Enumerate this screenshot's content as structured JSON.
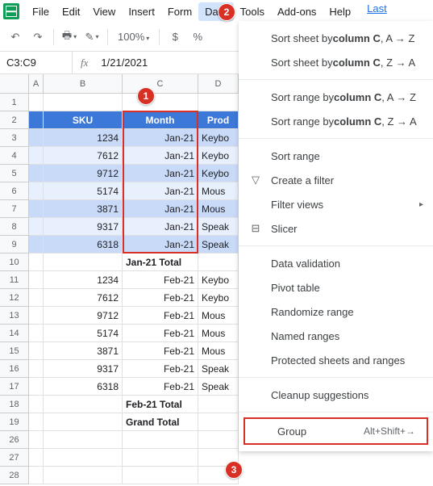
{
  "menu": {
    "items": [
      "File",
      "Edit",
      "View",
      "Insert",
      "Form",
      "Data",
      "Tools",
      "Add-ons",
      "Help"
    ],
    "last": "Last"
  },
  "toolbar": {
    "zoom": "100%",
    "currency": "$",
    "percent": "%"
  },
  "namebox": "C3:C9",
  "formula": "1/21/2021",
  "cols": [
    "A",
    "B",
    "C",
    "D"
  ],
  "headers": {
    "sku": "SKU",
    "month": "Month",
    "product": "Prod"
  },
  "rows": [
    {
      "n": "1",
      "B": "",
      "C": "",
      "D": ""
    },
    {
      "n": "2",
      "B": "SKU",
      "C": "Month",
      "D": "Prod",
      "hdr": true
    },
    {
      "n": "3",
      "B": "1234",
      "C": "Jan-21",
      "D": "Keybo",
      "band": "d"
    },
    {
      "n": "4",
      "B": "7612",
      "C": "Jan-21",
      "D": "Keybo",
      "band": "l"
    },
    {
      "n": "5",
      "B": "9712",
      "C": "Jan-21",
      "D": "Keybo",
      "band": "d"
    },
    {
      "n": "6",
      "B": "5174",
      "C": "Jan-21",
      "D": "Mous",
      "band": "l"
    },
    {
      "n": "7",
      "B": "3871",
      "C": "Jan-21",
      "D": "Mous",
      "band": "d"
    },
    {
      "n": "8",
      "B": "9317",
      "C": "Jan-21",
      "D": "Speak",
      "band": "l"
    },
    {
      "n": "9",
      "B": "6318",
      "C": "Jan-21",
      "D": "Speak",
      "band": "d"
    },
    {
      "n": "10",
      "B": "",
      "C": "Jan-21 Total",
      "D": "",
      "bold": true,
      "cL": true
    },
    {
      "n": "11",
      "B": "1234",
      "C": "Feb-21",
      "D": "Keybo"
    },
    {
      "n": "12",
      "B": "7612",
      "C": "Feb-21",
      "D": "Keybo"
    },
    {
      "n": "13",
      "B": "9712",
      "C": "Feb-21",
      "D": "Mous"
    },
    {
      "n": "14",
      "B": "5174",
      "C": "Feb-21",
      "D": "Mous"
    },
    {
      "n": "15",
      "B": "3871",
      "C": "Feb-21",
      "D": "Mous"
    },
    {
      "n": "16",
      "B": "9317",
      "C": "Feb-21",
      "D": "Speak"
    },
    {
      "n": "17",
      "B": "6318",
      "C": "Feb-21",
      "D": "Speak"
    },
    {
      "n": "18",
      "B": "",
      "C": "Feb-21 Total",
      "D": "",
      "bold": true,
      "cL": true
    },
    {
      "n": "19",
      "B": "",
      "C": "Grand Total",
      "D": "",
      "bold": true,
      "cL": true
    },
    {
      "n": "26",
      "B": "",
      "C": "",
      "D": ""
    },
    {
      "n": "27",
      "B": "",
      "C": "",
      "D": ""
    },
    {
      "n": "28",
      "B": "",
      "C": "",
      "D": ""
    }
  ],
  "dropdown": [
    {
      "t": "rich",
      "pre": "Sort sheet by ",
      "b": "column C",
      "post": ", A → Z"
    },
    {
      "t": "rich",
      "pre": "Sort sheet by ",
      "b": "column C",
      "post": ", Z → A"
    },
    {
      "t": "sep"
    },
    {
      "t": "rich",
      "pre": "Sort range by ",
      "b": "column C",
      "post": ", A → Z"
    },
    {
      "t": "rich",
      "pre": "Sort range by ",
      "b": "column C",
      "post": ", Z → A"
    },
    {
      "t": "sep"
    },
    {
      "t": "item",
      "label": "Sort range"
    },
    {
      "t": "item",
      "label": "Create a filter",
      "icon": "▽"
    },
    {
      "t": "item",
      "label": "Filter views",
      "sub": true
    },
    {
      "t": "item",
      "label": "Slicer",
      "icon": "⊟"
    },
    {
      "t": "sep"
    },
    {
      "t": "item",
      "label": "Data validation"
    },
    {
      "t": "item",
      "label": "Pivot table"
    },
    {
      "t": "item",
      "label": "Randomize range"
    },
    {
      "t": "item",
      "label": "Named ranges"
    },
    {
      "t": "item",
      "label": "Protected sheets and ranges"
    },
    {
      "t": "sep"
    },
    {
      "t": "item",
      "label": "Cleanup suggestions"
    },
    {
      "t": "sep"
    },
    {
      "t": "item",
      "label": "Group",
      "shortcut": "Alt+Shift+→",
      "hl": true
    }
  ],
  "badges": {
    "1": "1",
    "2": "2",
    "3": "3"
  }
}
